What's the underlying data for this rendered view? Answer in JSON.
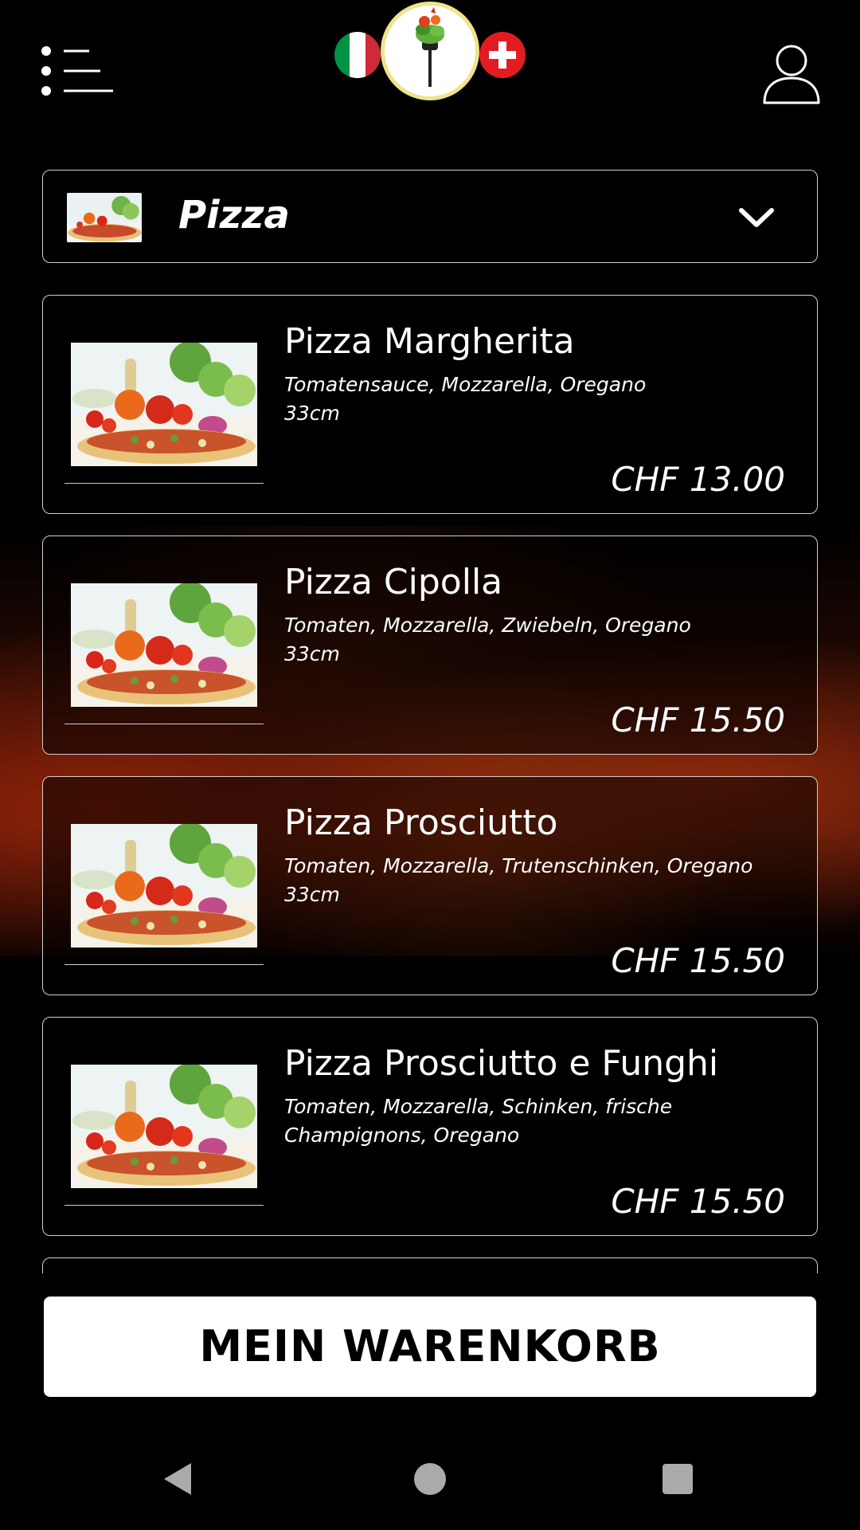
{
  "header": {
    "menu_icon": "menu-list-icon",
    "logo_icon": "fork-veggie-logo",
    "language_flags": [
      "italy-flag-icon",
      "switzerland-flag-icon"
    ],
    "user_icon": "user-icon"
  },
  "category": {
    "label": "Pizza",
    "dropdown_icon": "chevron-down-icon"
  },
  "products": [
    {
      "name": "Pizza Margherita",
      "description": "Tomatensauce, Mozzarella, Oregano\n33cm",
      "price": "CHF 13.00"
    },
    {
      "name": "Pizza Cipolla",
      "description": "Tomaten, Mozzarella, Zwiebeln, Oregano\n33cm",
      "price": "CHF 15.50"
    },
    {
      "name": "Pizza Prosciutto",
      "description": "Tomaten, Mozzarella, Trutenschinken, Oregano\n33cm",
      "price": "CHF 15.50"
    },
    {
      "name": "Pizza Prosciutto e Funghi",
      "description": "Tomaten, Mozzarella, Schinken, frische Champignons, Oregano",
      "price": "CHF 15.50"
    },
    {
      "name": "",
      "description": "",
      "price": ""
    }
  ],
  "cart": {
    "label": "MEIN WARENKORB"
  },
  "colors": {
    "background": "#000000",
    "border": "#cfcfcf",
    "cart_button": "#ffffff",
    "swiss_red": "#e31b23",
    "italy_green": "#009246",
    "italy_red": "#ce2b37"
  }
}
